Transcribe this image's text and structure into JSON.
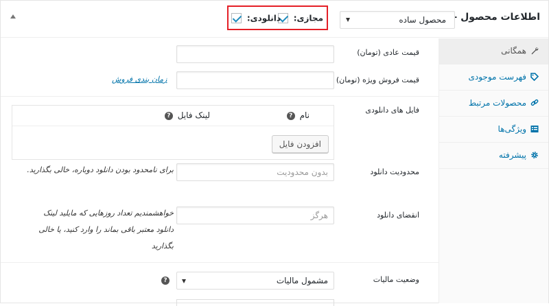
{
  "header": {
    "title": "اطلاعات محصول —",
    "product_type": "محصول ساده",
    "virtual_label": "مجازی:",
    "downloadable_label": "دانلودی:"
  },
  "tabs": [
    {
      "label": "همگانی",
      "icon": "wrench-icon",
      "active": true
    },
    {
      "label": "فهرست موجودی",
      "icon": "tag-icon",
      "active": false
    },
    {
      "label": "محصولات مرتبط",
      "icon": "link-icon",
      "active": false
    },
    {
      "label": "ویژگی‌ها",
      "icon": "list-icon",
      "active": false
    },
    {
      "label": "پیشرفته",
      "icon": "gear-icon",
      "active": false
    }
  ],
  "fields": {
    "regular_price_label": "قیمت عادی (تومان)",
    "sale_price_label": "قیمت فروش ویژه (تومان)",
    "schedule_link": "زمان بندی فروش",
    "downloadable_files_label": "فایل های دانلودی",
    "files_col_name": "نام",
    "files_col_url": "لینک فایل",
    "add_file_button": "افزودن فایل",
    "download_limit_label": "محدودیت دانلود",
    "download_limit_placeholder": "بدون محدودیت",
    "download_limit_desc": "برای نامحدود بودن دانلود دوباره، خالی بگذارید.",
    "download_expiry_label": "انقضای دانلود",
    "download_expiry_placeholder": "هرگز",
    "download_expiry_desc": "خواهشمندیم تعداد روزهایی که مایلید لینک دانلود معتبر باقی بماند را وارد کنید، یا خالی بگذارید",
    "tax_status_label": "وضعیت مالیات",
    "tax_status_value": "مشمول مالیات"
  },
  "colors": {
    "link": "#0073aa",
    "highlight": "#e41e26",
    "check": "#1e8cbe"
  }
}
